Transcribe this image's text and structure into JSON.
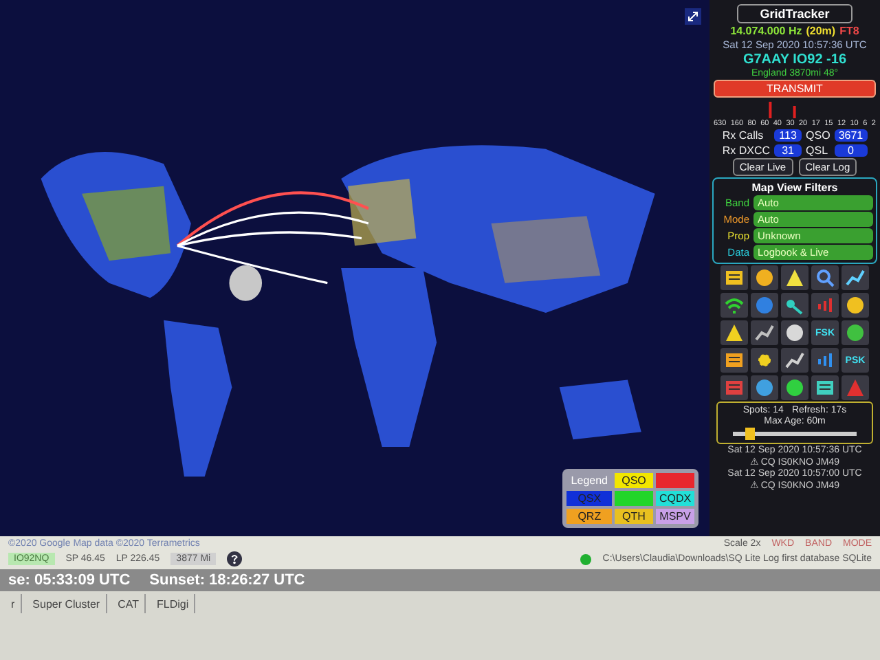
{
  "map": {
    "credits": "©2020 Google  Map data ©2020 Terrametrics"
  },
  "legend": {
    "title": "Legend",
    "items": [
      {
        "label": "QSO",
        "color": "#f2e600"
      },
      {
        "color": "#e8262e"
      },
      {
        "label": "QSX",
        "color": "#1030d8"
      },
      {
        "color": "#22d52a"
      },
      {
        "label": "CQDX",
        "color": "#22e0d8"
      },
      {
        "label": "QRZ",
        "color": "#f0a020"
      },
      {
        "label": "QTH",
        "color": "#e8c020"
      },
      {
        "label": "MSPV",
        "color": "#c8a0e8"
      }
    ]
  },
  "panel": {
    "title": "GridTracker",
    "frequency": "14.074.000 Hz",
    "band": "(20m)",
    "mode": "FT8",
    "datetime": "Sat 12 Sep 2020 10:57:36 UTC",
    "station": "G7AAY IO92 -16",
    "location": "England 3870mi 48°",
    "transmit": "TRANSMIT",
    "band_scale": [
      "630",
      "160",
      "80",
      "60",
      "40",
      "30",
      "20",
      "17",
      "15",
      "12",
      "10",
      "6",
      "2"
    ],
    "stats": [
      {
        "label": "Rx Calls",
        "value": "113"
      },
      {
        "label": "QSO",
        "value": "3671"
      },
      {
        "label": "Rx DXCC",
        "value": "31"
      },
      {
        "label": "QSL",
        "value": "0"
      }
    ],
    "buttons": [
      "Clear Live",
      "Clear Log"
    ],
    "filters": {
      "title": "Map View Filters",
      "rows": [
        {
          "label": "Band",
          "value": "Auto",
          "color": "#3fd23f"
        },
        {
          "label": "Mode",
          "value": "Auto",
          "color": "#f09a2a"
        },
        {
          "label": "Prop",
          "value": "Unknown",
          "color": "#e8e030"
        },
        {
          "label": "Data",
          "value": "Logbook & Live",
          "color": "#2ad0e0"
        }
      ]
    },
    "tool_labels": [
      "FSK",
      "PSK"
    ],
    "spots": {
      "spots": "Spots: 14",
      "refresh": "Refresh: 17s",
      "max_age": "Max Age: 60m",
      "level": 0.1
    },
    "decodes": [
      "Sat 12 Sep 2020 10:57:36 UTC",
      "⚠ CQ IS0KNO JM49",
      "Sat 12 Sep 2020 10:57:00 UTC",
      "⚠ CQ IS0KNO JM49"
    ]
  },
  "info_bar": {
    "locator": "IO92NQ",
    "short_path": "SP 46.45",
    "long_path": "LP 226.45",
    "distance": "3877 Mi",
    "scale": "Scale 2x",
    "toggles": [
      "WKD",
      "BAND",
      "MODE"
    ],
    "file_path": "C:\\Users\\Claudia\\Downloads\\SQ Lite Log first database SQLite"
  },
  "sun_bar": {
    "sunrise": "se: 05:33:09 UTC",
    "sunset": "Sunset: 18:26:27 UTC"
  },
  "taskbar": [
    "r",
    "Super Cluster",
    "CAT",
    "FLDigi"
  ]
}
